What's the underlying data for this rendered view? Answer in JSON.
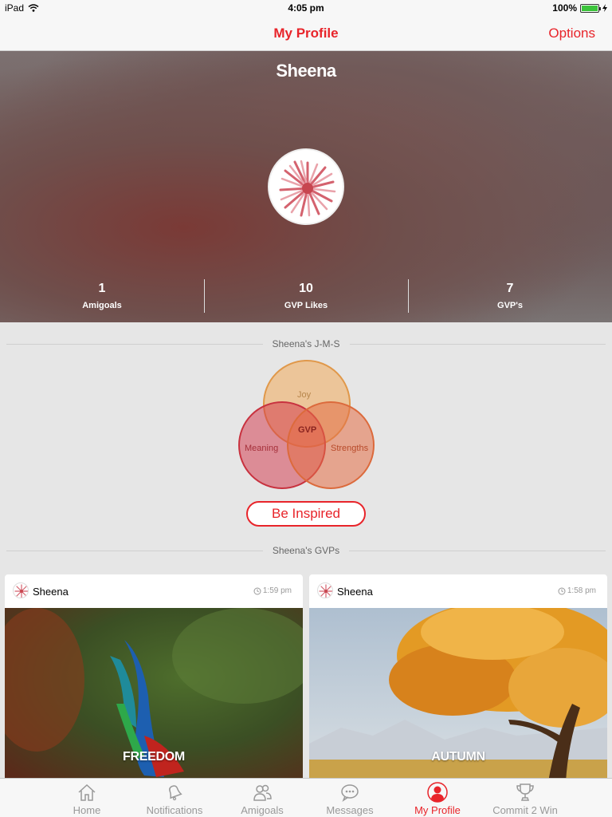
{
  "status": {
    "device": "iPad",
    "time": "4:05 pm",
    "battery": "100%",
    "battery_level": 1.0
  },
  "nav": {
    "title": "My Profile",
    "options_label": "Options"
  },
  "profile": {
    "name": "Sheena",
    "stats": [
      {
        "value": "1",
        "label": "Amigoals"
      },
      {
        "value": "10",
        "label": "GVP Likes"
      },
      {
        "value": "7",
        "label": "GVP's"
      }
    ]
  },
  "jms": {
    "title": "Sheena's J-M-S",
    "labels": {
      "joy": "Joy",
      "meaning": "Meaning",
      "strengths": "Strengths",
      "gvp": "GVP"
    }
  },
  "inspire_button": "Be Inspired",
  "gvps": {
    "title": "Sheena's GVPs",
    "cards": [
      {
        "user": "Sheena",
        "time": "1:59 pm",
        "caption": "FREEDOM"
      },
      {
        "user": "Sheena",
        "time": "1:58 pm",
        "caption": "AUTUMN"
      }
    ]
  },
  "tabs": [
    {
      "label": "Home",
      "icon": "home-icon"
    },
    {
      "label": "Notifications",
      "icon": "bell-icon"
    },
    {
      "label": "Amigoals",
      "icon": "people-icon"
    },
    {
      "label": "Messages",
      "icon": "chat-bubble-icon"
    },
    {
      "label": "My Profile",
      "icon": "person-icon",
      "active": true
    },
    {
      "label": "Commit 2 Win",
      "icon": "trophy-icon"
    }
  ],
  "colors": {
    "accent": "#e8242a",
    "background": "#e6e6e6"
  }
}
